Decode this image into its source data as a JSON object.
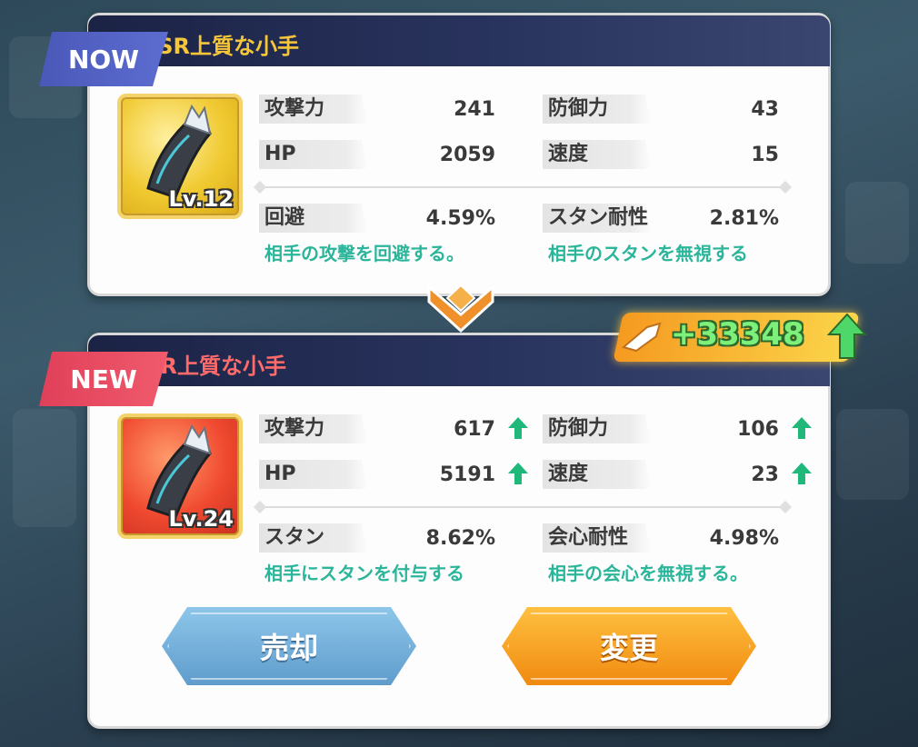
{
  "now": {
    "tag": "NOW",
    "item_name": "SSR上質な小手",
    "level": "Lv.12",
    "stats": {
      "atk": {
        "label": "攻撃力",
        "value": "241"
      },
      "def": {
        "label": "防御力",
        "value": "43"
      },
      "hp": {
        "label": "HP",
        "value": "2059"
      },
      "spd": {
        "label": "速度",
        "value": "15"
      },
      "sub1": {
        "label": "回避",
        "value": "4.59%"
      },
      "sub2": {
        "label": "スタン耐性",
        "value": "2.81%"
      }
    },
    "desc1": "相手の攻撃を回避する。",
    "desc2": "相手のスタンを無視する"
  },
  "new": {
    "tag": "NEW",
    "item_name": "UR上質な小手",
    "level": "Lv.24",
    "stats": {
      "atk": {
        "label": "攻撃力",
        "value": "617"
      },
      "def": {
        "label": "防御力",
        "value": "106"
      },
      "hp": {
        "label": "HP",
        "value": "5191"
      },
      "spd": {
        "label": "速度",
        "value": "23"
      },
      "sub1": {
        "label": "スタン",
        "value": "8.62%"
      },
      "sub2": {
        "label": "会心耐性",
        "value": "4.98%"
      }
    },
    "desc1": "相手にスタンを付与する",
    "desc2": "相手の会心を無視する。"
  },
  "power_change": "+33348",
  "buttons": {
    "sell": "売却",
    "change": "変更"
  },
  "colors": {
    "stat_up_arrow": "#1fb77a",
    "desc_text": "#2bb59a",
    "now_tag": "#4a59b8",
    "new_tag": "#e0405a"
  }
}
